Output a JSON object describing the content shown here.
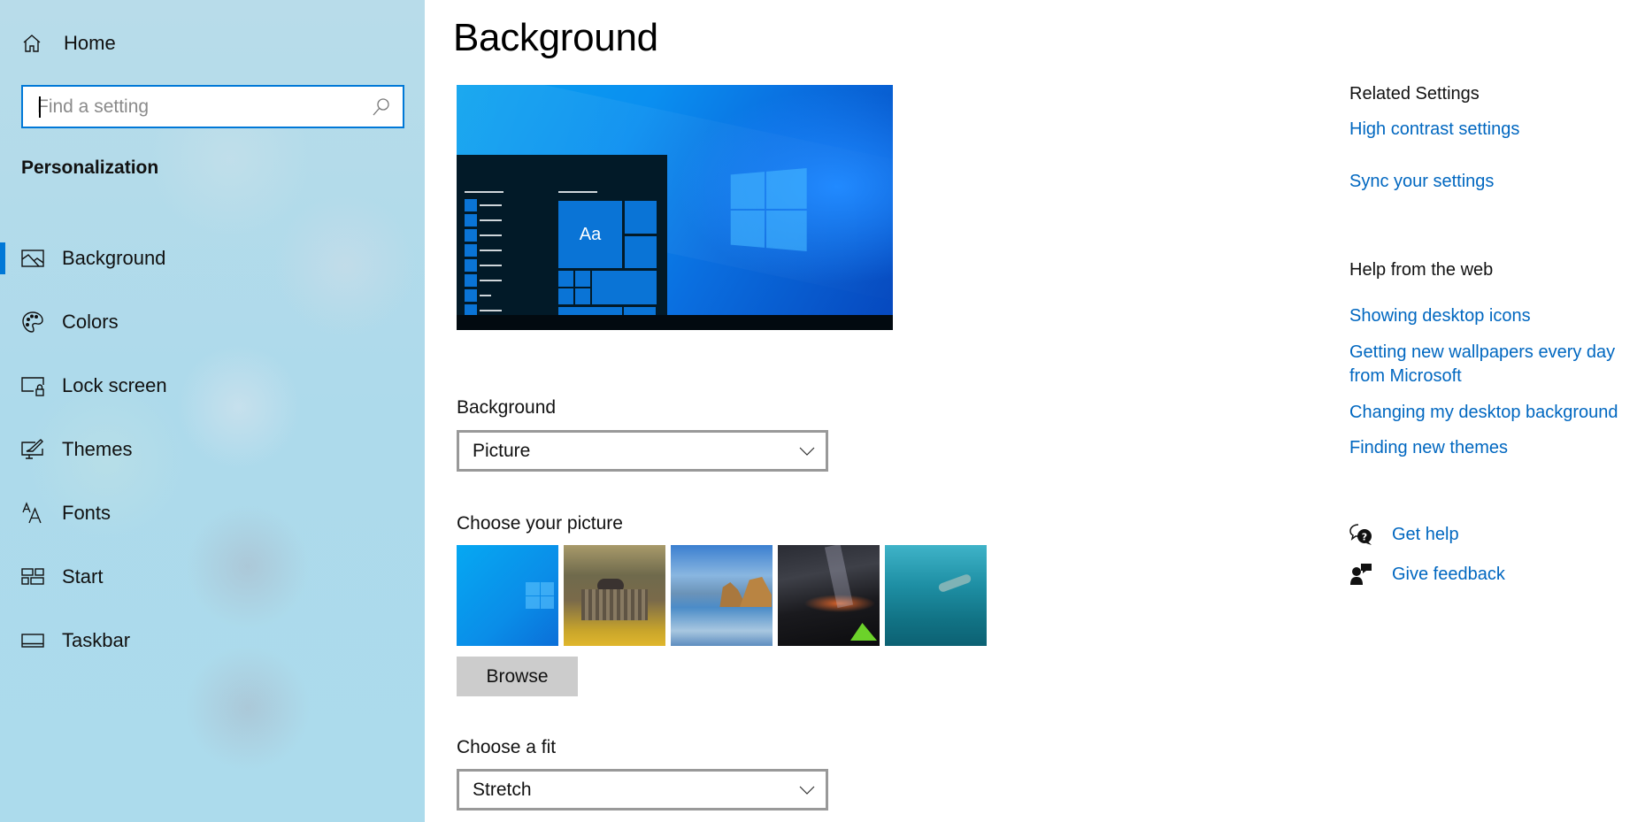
{
  "sidebar": {
    "home_label": "Home",
    "search": {
      "placeholder": "Find a setting",
      "value": ""
    },
    "section_title": "Personalization",
    "items": [
      {
        "label": "Background",
        "icon": "picture-icon",
        "selected": true
      },
      {
        "label": "Colors",
        "icon": "palette-icon",
        "selected": false
      },
      {
        "label": "Lock screen",
        "icon": "lock-screen-icon",
        "selected": false
      },
      {
        "label": "Themes",
        "icon": "themes-icon",
        "selected": false
      },
      {
        "label": "Fonts",
        "icon": "fonts-icon",
        "selected": false
      },
      {
        "label": "Start",
        "icon": "start-icon",
        "selected": false
      },
      {
        "label": "Taskbar",
        "icon": "taskbar-icon",
        "selected": false
      }
    ]
  },
  "main": {
    "title": "Background",
    "preview": {
      "tile_text": "Aa"
    },
    "background_field": {
      "label": "Background",
      "value": "Picture"
    },
    "picture_field": {
      "label": "Choose your picture",
      "thumbnails": [
        "Windows light",
        "Bench in garden",
        "Beach rocks",
        "Night sky tent",
        "Underwater swimmer"
      ],
      "browse_label": "Browse"
    },
    "fit_field": {
      "label": "Choose a fit",
      "value": "Stretch"
    }
  },
  "related": {
    "heading": "Related Settings",
    "links": [
      "High contrast settings",
      "Sync your settings"
    ]
  },
  "help_web": {
    "heading": "Help from the web",
    "links": [
      "Showing desktop icons",
      "Getting new wallpapers every day from Microsoft",
      "Changing my desktop background",
      "Finding new themes"
    ]
  },
  "support": {
    "get_help": "Get help",
    "give_feedback": "Give feedback"
  },
  "colors": {
    "accent": "#0078d7",
    "link": "#0067c0"
  }
}
